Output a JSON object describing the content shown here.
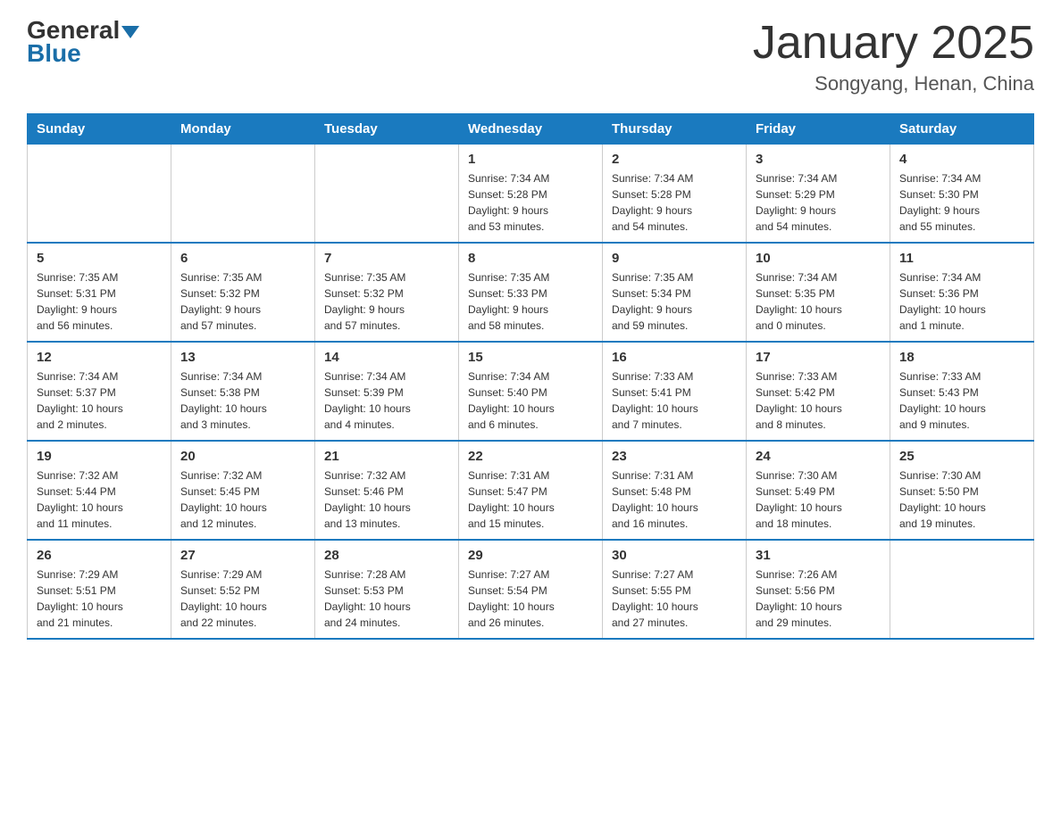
{
  "header": {
    "logo_general": "General",
    "logo_blue": "Blue",
    "title": "January 2025",
    "subtitle": "Songyang, Henan, China"
  },
  "days_of_week": [
    "Sunday",
    "Monday",
    "Tuesday",
    "Wednesday",
    "Thursday",
    "Friday",
    "Saturday"
  ],
  "weeks": [
    [
      {
        "day": "",
        "info": ""
      },
      {
        "day": "",
        "info": ""
      },
      {
        "day": "",
        "info": ""
      },
      {
        "day": "1",
        "info": "Sunrise: 7:34 AM\nSunset: 5:28 PM\nDaylight: 9 hours\nand 53 minutes."
      },
      {
        "day": "2",
        "info": "Sunrise: 7:34 AM\nSunset: 5:28 PM\nDaylight: 9 hours\nand 54 minutes."
      },
      {
        "day": "3",
        "info": "Sunrise: 7:34 AM\nSunset: 5:29 PM\nDaylight: 9 hours\nand 54 minutes."
      },
      {
        "day": "4",
        "info": "Sunrise: 7:34 AM\nSunset: 5:30 PM\nDaylight: 9 hours\nand 55 minutes."
      }
    ],
    [
      {
        "day": "5",
        "info": "Sunrise: 7:35 AM\nSunset: 5:31 PM\nDaylight: 9 hours\nand 56 minutes."
      },
      {
        "day": "6",
        "info": "Sunrise: 7:35 AM\nSunset: 5:32 PM\nDaylight: 9 hours\nand 57 minutes."
      },
      {
        "day": "7",
        "info": "Sunrise: 7:35 AM\nSunset: 5:32 PM\nDaylight: 9 hours\nand 57 minutes."
      },
      {
        "day": "8",
        "info": "Sunrise: 7:35 AM\nSunset: 5:33 PM\nDaylight: 9 hours\nand 58 minutes."
      },
      {
        "day": "9",
        "info": "Sunrise: 7:35 AM\nSunset: 5:34 PM\nDaylight: 9 hours\nand 59 minutes."
      },
      {
        "day": "10",
        "info": "Sunrise: 7:34 AM\nSunset: 5:35 PM\nDaylight: 10 hours\nand 0 minutes."
      },
      {
        "day": "11",
        "info": "Sunrise: 7:34 AM\nSunset: 5:36 PM\nDaylight: 10 hours\nand 1 minute."
      }
    ],
    [
      {
        "day": "12",
        "info": "Sunrise: 7:34 AM\nSunset: 5:37 PM\nDaylight: 10 hours\nand 2 minutes."
      },
      {
        "day": "13",
        "info": "Sunrise: 7:34 AM\nSunset: 5:38 PM\nDaylight: 10 hours\nand 3 minutes."
      },
      {
        "day": "14",
        "info": "Sunrise: 7:34 AM\nSunset: 5:39 PM\nDaylight: 10 hours\nand 4 minutes."
      },
      {
        "day": "15",
        "info": "Sunrise: 7:34 AM\nSunset: 5:40 PM\nDaylight: 10 hours\nand 6 minutes."
      },
      {
        "day": "16",
        "info": "Sunrise: 7:33 AM\nSunset: 5:41 PM\nDaylight: 10 hours\nand 7 minutes."
      },
      {
        "day": "17",
        "info": "Sunrise: 7:33 AM\nSunset: 5:42 PM\nDaylight: 10 hours\nand 8 minutes."
      },
      {
        "day": "18",
        "info": "Sunrise: 7:33 AM\nSunset: 5:43 PM\nDaylight: 10 hours\nand 9 minutes."
      }
    ],
    [
      {
        "day": "19",
        "info": "Sunrise: 7:32 AM\nSunset: 5:44 PM\nDaylight: 10 hours\nand 11 minutes."
      },
      {
        "day": "20",
        "info": "Sunrise: 7:32 AM\nSunset: 5:45 PM\nDaylight: 10 hours\nand 12 minutes."
      },
      {
        "day": "21",
        "info": "Sunrise: 7:32 AM\nSunset: 5:46 PM\nDaylight: 10 hours\nand 13 minutes."
      },
      {
        "day": "22",
        "info": "Sunrise: 7:31 AM\nSunset: 5:47 PM\nDaylight: 10 hours\nand 15 minutes."
      },
      {
        "day": "23",
        "info": "Sunrise: 7:31 AM\nSunset: 5:48 PM\nDaylight: 10 hours\nand 16 minutes."
      },
      {
        "day": "24",
        "info": "Sunrise: 7:30 AM\nSunset: 5:49 PM\nDaylight: 10 hours\nand 18 minutes."
      },
      {
        "day": "25",
        "info": "Sunrise: 7:30 AM\nSunset: 5:50 PM\nDaylight: 10 hours\nand 19 minutes."
      }
    ],
    [
      {
        "day": "26",
        "info": "Sunrise: 7:29 AM\nSunset: 5:51 PM\nDaylight: 10 hours\nand 21 minutes."
      },
      {
        "day": "27",
        "info": "Sunrise: 7:29 AM\nSunset: 5:52 PM\nDaylight: 10 hours\nand 22 minutes."
      },
      {
        "day": "28",
        "info": "Sunrise: 7:28 AM\nSunset: 5:53 PM\nDaylight: 10 hours\nand 24 minutes."
      },
      {
        "day": "29",
        "info": "Sunrise: 7:27 AM\nSunset: 5:54 PM\nDaylight: 10 hours\nand 26 minutes."
      },
      {
        "day": "30",
        "info": "Sunrise: 7:27 AM\nSunset: 5:55 PM\nDaylight: 10 hours\nand 27 minutes."
      },
      {
        "day": "31",
        "info": "Sunrise: 7:26 AM\nSunset: 5:56 PM\nDaylight: 10 hours\nand 29 minutes."
      },
      {
        "day": "",
        "info": ""
      }
    ]
  ]
}
